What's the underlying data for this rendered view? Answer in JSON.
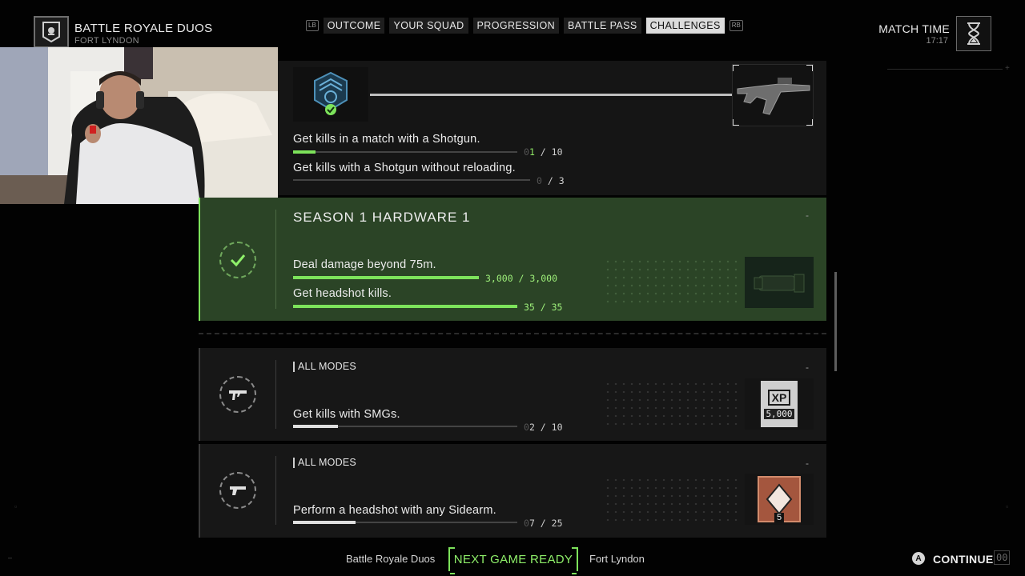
{
  "header": {
    "mode_title": "BATTLE ROYALE DUOS",
    "mode_sub": "FORT LYNDON",
    "left_bumper": "LB",
    "right_bumper": "RB",
    "tabs": [
      {
        "label": "OUTCOME",
        "active": false
      },
      {
        "label": "YOUR SQUAD",
        "active": false
      },
      {
        "label": "PROGRESSION",
        "active": false
      },
      {
        "label": "BATTLE PASS",
        "active": false
      },
      {
        "label": "CHALLENGES",
        "active": true
      }
    ],
    "match_time_label": "MATCH TIME",
    "match_time_value": "17:17"
  },
  "top_card": {
    "reward_index_1": "1",
    "reward_index_2": "2",
    "challenges": [
      {
        "text": "Get kills in a match with a Shotgun.",
        "count_dim": "0",
        "count_main": "1",
        "count_total": " / 10",
        "progress": 0.1
      },
      {
        "text": "Get kills with a Shotgun without reloading.",
        "count_dim": "0",
        "count_main": "",
        "count_total": " / 3",
        "progress": 0.0
      }
    ]
  },
  "season_card": {
    "title": "SEASON 1 HARDWARE 1",
    "dash": "-",
    "challenges": [
      {
        "text": "Deal damage beyond 75m.",
        "count": "3,000 / 3,000",
        "progress": 1.0
      },
      {
        "text": "Get headshot kills.",
        "count": "35 / 35",
        "progress": 1.0
      }
    ]
  },
  "challenge_cards": [
    {
      "mode": "ALL MODES",
      "dash": "-",
      "text": "Get kills with SMGs.",
      "count_dim": "0",
      "count_main": "2",
      "count_total": " / 10",
      "progress": 0.2,
      "reward_label": "XP",
      "reward_value": "5,000"
    },
    {
      "mode": "ALL MODES",
      "dash": "-",
      "text": "Perform a headshot with any Sidearm.",
      "count_dim": "0",
      "count_main": "7",
      "count_total": " / 25",
      "progress": 0.28,
      "reward_label": "5"
    }
  ],
  "footer": {
    "left_text": "Battle Royale Duos",
    "next_game": "NEXT GAME READY",
    "right_text": "Fort Lyndon",
    "a_button": "A",
    "continue": "CONTINUE",
    "continue_timer": "00"
  },
  "colors": {
    "accent_green": "#7de35b",
    "season_bg": "#2b4426",
    "panel_bg": "#171717"
  }
}
